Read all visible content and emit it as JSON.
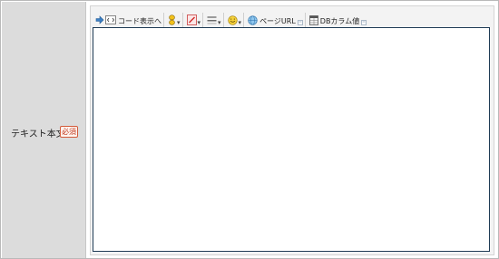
{
  "field": {
    "label": "テキスト本文",
    "required_badge": "必須"
  },
  "toolbar": {
    "code_view_label": "コード表示へ",
    "page_url_label": "ページURL",
    "db_column_label": "DBカラム値"
  },
  "editor": {
    "content": ""
  },
  "colors": {
    "label_bg": "#dcdcdc",
    "badge_border": "#d25a3a",
    "editor_border": "#1f3b55"
  }
}
